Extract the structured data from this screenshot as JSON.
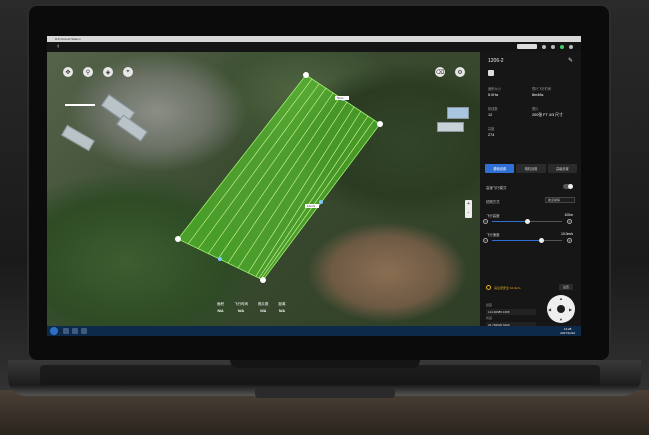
{
  "window": {
    "title": "DJI Ground Station"
  },
  "topbar": {
    "back_icon": "chevron-left-icon",
    "status_pill": "",
    "signal_labels": [
      "",
      "",
      "",
      ""
    ]
  },
  "map": {
    "tools": [
      "compass-icon",
      "pin-icon",
      "layers-icon",
      "ruler-icon"
    ],
    "right_tools": [
      "erase-icon",
      "settings-icon"
    ],
    "zoom_plus": "+",
    "zoom_minus": "-",
    "route_labels": [
      "5m/s",
      "12m/s"
    ],
    "stats": [
      {
        "label": "面积",
        "value": "N/A"
      },
      {
        "label": "飞行时间",
        "value": "N/A"
      },
      {
        "label": "照片数",
        "value": "N/A"
      },
      {
        "label": "距离",
        "value": "N/A"
      }
    ]
  },
  "panel": {
    "title": "1206-2",
    "edit_icon": "pencil-icon",
    "save_icon": "save-icon",
    "info": [
      {
        "label": "面积大小",
        "value": "5.0Ha"
      },
      {
        "label": "预计飞行时间",
        "value": "8m46s"
      },
      {
        "label": "航线数",
        "value": "12"
      },
      {
        "label": "照片",
        "value": "200张 FT 4/3 尺寸"
      },
      {
        "label": "高度",
        "value": "274"
      }
    ],
    "tabs": [
      "基础设置",
      "相机设置",
      "高级设置"
    ],
    "active_tab": 0,
    "rows": {
      "mode_label": "高速飞行模式",
      "camera_label": "拍照方式",
      "camera_value": "航点悬停",
      "height_label": "飞行高度",
      "height_value": "100m",
      "speed_label": "飞行速度",
      "speed_value": "10.0m/s"
    },
    "sliders": {
      "height_fraction": 0.5,
      "speed_fraction": 0.7
    },
    "warning": "请注意安全  10.0m/s",
    "set_button": "设置",
    "fields": [
      {
        "label": "经度",
        "value": "114.30685 1395"
      },
      {
        "label": "纬度",
        "value": "22.784620 6206"
      }
    ],
    "joystick": {
      "up": "▲",
      "down": "▼",
      "left": "◀",
      "right": "▶"
    },
    "buttons": {
      "primary": "开始飞行",
      "secondary": "取消飞行"
    }
  },
  "taskbar": {
    "start_icon": "windows-icon",
    "time": "14:28",
    "date": "2017/11/24"
  },
  "colors": {
    "panel_bg": "#161616",
    "accent": "#2f6fd6",
    "route_green": "#5ee12b",
    "warning": "#e5b02a"
  }
}
